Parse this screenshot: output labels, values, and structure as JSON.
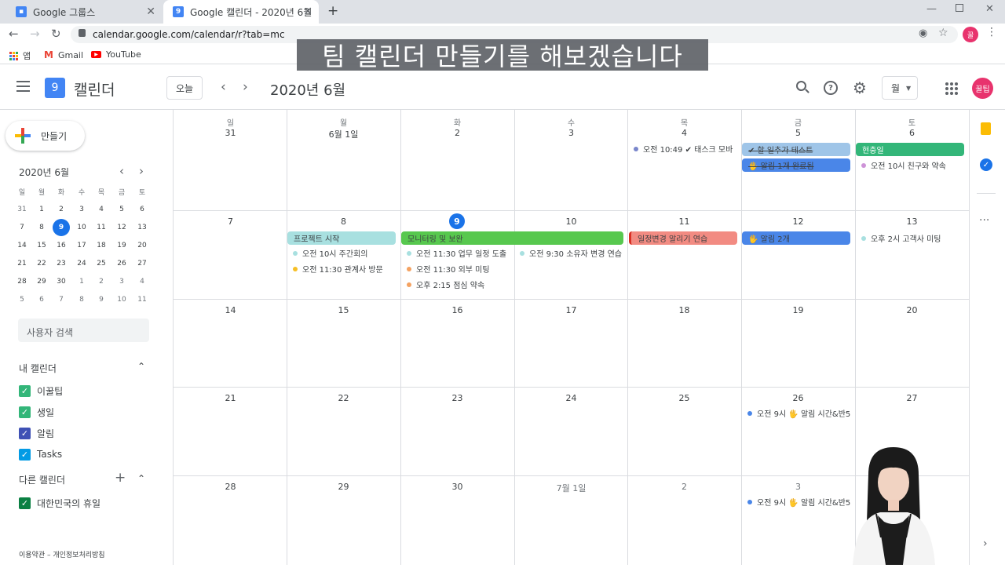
{
  "browser": {
    "tabs": [
      {
        "title": "Google 그룹스"
      },
      {
        "title": "Google 캘린더 - 2020년 6월"
      }
    ],
    "new_tab": "+",
    "url": "calendar.google.com/calendar/r?tab=mc",
    "bookmarks": [
      "앱",
      "Gmail",
      "YouTube"
    ],
    "profile_initial": "꿀"
  },
  "caption": "팀 캘린더 만들기를 해보겠습니다",
  "header": {
    "app_name": "캘린더",
    "logo_day": "9",
    "today_button": "오늘",
    "current_period": "2020년 6월",
    "view_select": "월",
    "avatar": "꿀팁"
  },
  "sidebar": {
    "create_label": "만들기",
    "mini_title": "2020년 6월",
    "mini_dow": [
      "일",
      "월",
      "화",
      "수",
      "목",
      "금",
      "토"
    ],
    "mini_weeks": [
      [
        "31",
        "1",
        "2",
        "3",
        "4",
        "5",
        "6"
      ],
      [
        "7",
        "8",
        "9",
        "10",
        "11",
        "12",
        "13"
      ],
      [
        "14",
        "15",
        "16",
        "17",
        "18",
        "19",
        "20"
      ],
      [
        "21",
        "22",
        "23",
        "24",
        "25",
        "26",
        "27"
      ],
      [
        "28",
        "29",
        "30",
        "1",
        "2",
        "3",
        "4"
      ],
      [
        "5",
        "6",
        "7",
        "8",
        "9",
        "10",
        "11"
      ]
    ],
    "search_people": "사용자 검색",
    "my_calendars_title": "내 캘린더",
    "my_calendars": [
      {
        "name": "이꿀팁",
        "color": "#33b679"
      },
      {
        "name": "생일",
        "color": "#33b679"
      },
      {
        "name": "알림",
        "color": "#3f51b5"
      },
      {
        "name": "Tasks",
        "color": "#039be5"
      }
    ],
    "other_calendars_title": "다른 캘린더",
    "other_calendars": [
      {
        "name": "대한민국의 휴일",
        "color": "#0b8043"
      }
    ],
    "footer": "이용약관 – 개인정보처리방침"
  },
  "grid": {
    "dow": [
      "일",
      "월",
      "화",
      "수",
      "목",
      "금",
      "토"
    ],
    "weeks": [
      [
        "31",
        "6월 1일",
        "2",
        "3",
        "4",
        "5",
        "6"
      ],
      [
        "7",
        "8",
        "9",
        "10",
        "11",
        "12",
        "13"
      ],
      [
        "14",
        "15",
        "16",
        "17",
        "18",
        "19",
        "20"
      ],
      [
        "21",
        "22",
        "23",
        "24",
        "25",
        "26",
        "27"
      ],
      [
        "28",
        "29",
        "30",
        "7월 1일",
        "2",
        "3",
        ""
      ]
    ],
    "events": {
      "w1_thu": "오전 10:49 ✔ 태스크 모바",
      "w1_fri_1": "✔ 할 일추가 테스트",
      "w1_fri_2": "🖐 알림 1개 완료됨",
      "w1_sat_1": "현충일",
      "w1_sat_2": "오전 10시 친구와 약속",
      "w2_mon_bar": "프로젝트 시작",
      "w2_mon_1": "오전 10시 주간회의",
      "w2_mon_2": "오전 11:30 관계사 방문",
      "w2_tue_bar": "모니터링 및 보완",
      "w2_tue_1": "오전 11:30 업무 일정 도출",
      "w2_tue_2": "오전 11:30 외부 미팅",
      "w2_tue_3": "오후 2:15 점심 약속",
      "w2_wed_1": "오전 9:30 소유자 변경 연습",
      "w2_thu_bar": "일정변경 알리기 연습",
      "w2_fri_bar": "🖐 알림 2개",
      "w2_sat_1": "오후 2시 고객사 미팅",
      "w4_fri_1": "오전 9시 🖐 알림 시간&반5",
      "w5_fri_1": "오전 9시 🖐 알림 시간&반5"
    }
  },
  "colors": {
    "blue": "#1a73e8",
    "green_bar": "#33b679",
    "teal_bar": "#a8e0e0",
    "green_long": "#57c84e",
    "salmon": "#f28b82",
    "alert_blue": "#4a86e8",
    "done_blue": "#9fc5e8"
  }
}
